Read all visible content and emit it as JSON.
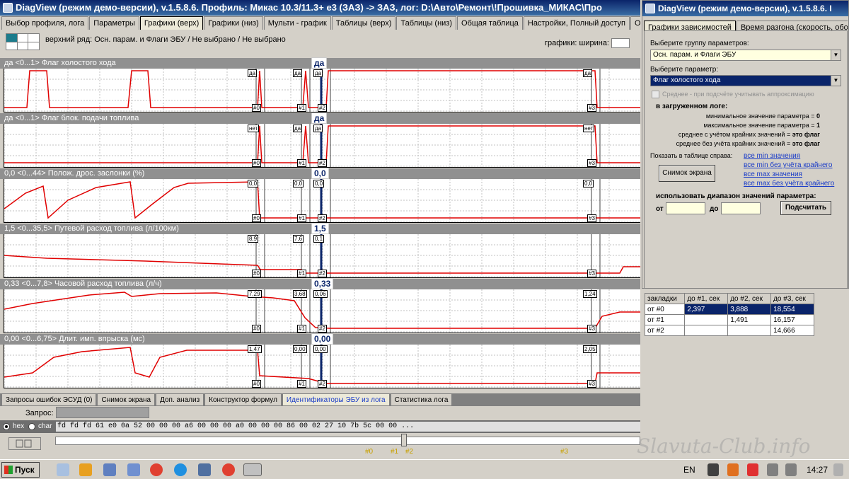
{
  "main_window": {
    "title": "DiagView (режим демо-версии), v.1.5.8.6. Профиль: Микас 10.3/11.3+ e3 (ЗАЗ) -> ЗАЗ,    лог: D:\\Авто\\Ремонт\\!Прошивка_МИКАС\\Про",
    "tabs": [
      "Выбор профиля, лога",
      "Параметры",
      "Графики (верх)",
      "Графики (низ)",
      "Мульти - график",
      "Таблицы (верх)",
      "Таблицы (низ)",
      "Общая таблица",
      "Настройки, Полный доступ",
      "О"
    ],
    "active_tab": "Графики (верх)",
    "top_row_label": "верхний ряд: Осн. парам. и Флаги ЭБУ / Не выбрано / Не выбрано",
    "graphs_label": "графики:  ширина:",
    "colors": {
      "header_bg": "#909090",
      "trace": "#e00000",
      "cursor": "#0a246a"
    }
  },
  "panels": [
    {
      "header": "да   <0...1>  Флаг холостого хода",
      "current": "да",
      "markers": [
        {
          "value": "да",
          "label": "#0"
        },
        {
          "value": "да",
          "label": "#1"
        },
        {
          "value": "да",
          "label": "#2"
        },
        {
          "value": "да",
          "label": "#3"
        }
      ]
    },
    {
      "header": "да   <0...1>  Флаг блок. подачи топлива",
      "current": "да",
      "markers": [
        {
          "value": "нет",
          "label": "#0"
        },
        {
          "value": "да",
          "label": "#1"
        },
        {
          "value": "да",
          "label": "#2"
        },
        {
          "value": "нет",
          "label": "#3"
        }
      ]
    },
    {
      "header": "0,0    <0...44>  Полож. дрос. заслонки (%)",
      "current": "0,0",
      "markers": [
        {
          "value": "0,0",
          "label": "#0"
        },
        {
          "value": "0,0",
          "label": "#1"
        },
        {
          "value": "0,0",
          "label": "#2"
        },
        {
          "value": "0,0",
          "label": "#3"
        }
      ]
    },
    {
      "header": "1,5    <0...35,5>  Путевой расход топлива (л/100км)",
      "current": "1,5",
      "markers": [
        {
          "value": "8,9",
          "label": "#0"
        },
        {
          "value": "7,6",
          "label": "#1"
        },
        {
          "value": "0,1",
          "label": "#2"
        },
        {
          "value": "",
          "label": "#3"
        }
      ]
    },
    {
      "header": "0,33    <0...7,8>  Часовой расход топлива (л/ч)",
      "current": "0,33",
      "markers": [
        {
          "value": "7,29",
          "label": "#0"
        },
        {
          "value": "3,68",
          "label": "#1"
        },
        {
          "value": "0,06",
          "label": "#2"
        },
        {
          "value": "1,24",
          "label": "#3"
        }
      ]
    },
    {
      "header": "0,00    <0...6,75>  Длит. имп. впрыска (мс)",
      "current": "0,00",
      "markers": [
        {
          "value": "1,47",
          "label": "#0"
        },
        {
          "value": "0,00",
          "label": "#1"
        },
        {
          "value": "0,00",
          "label": "#2"
        },
        {
          "value": "2,05",
          "label": "#3"
        }
      ]
    }
  ],
  "bottom": {
    "tabs": [
      "Запросы ошибок ЭСУД (0)",
      "Снимок экрана",
      "Доп. анализ",
      "Конструктор формул",
      "Идентификаторы ЭБУ из лога",
      "Статистика лога"
    ],
    "request_label": "Запрос:",
    "radio_hex": "hex",
    "radio_char": "char",
    "hexdump": "fd fd fd 61 e0 0a 52 00 00 00 a6 00 00 00 a0 00 00 00 86 00 02 27 10 7b 5c 00 00 ...",
    "timeline_marks": [
      "#0",
      "#1",
      "#2",
      "#3"
    ]
  },
  "side_window": {
    "title": "DiagView (режим демо-версии), v.1.5.8.6. I",
    "tabs": [
      "Графики зависимостей",
      "Время разгона (скорость, обороты и т"
    ],
    "group_label": "Выберите группу параметров:",
    "group_value": "Осн. парам. и Флаги ЭБУ",
    "param_label": "Выберите параметр:",
    "param_value": "Флаг холостого хода",
    "checkbox_label": "Среднее - при подсчёте учитывать аппроксимацию",
    "loaded_label": "в загруженном логе:",
    "min_label": "минимальное значение параметра =",
    "min_value": "0",
    "max_label": "максимальное значение параметра =",
    "max_value": "1",
    "avg1_label": "среднее с учётом крайних значений =",
    "avg1_value": "это флаг",
    "avg2_label": "среднее без учёта крайних значений =",
    "avg2_value": "это флаг",
    "show_label": "Показать в таблице справа:",
    "links": [
      "все min значения",
      "все min без учёта крайнего",
      "все max значения",
      "все max без учёта крайнего"
    ],
    "snapshot_button": "Снимок экрана",
    "range_label": "использовать диапазон значений параметра:",
    "from_label": "от",
    "to_label": "до",
    "calc_button": "Подсчитать"
  },
  "stats_table": {
    "headers": [
      "закладки",
      "до #1, сек",
      "до #2, сек",
      "до #3, сек"
    ],
    "rows": [
      [
        "от #0",
        "2,397",
        "3,888",
        "18,554"
      ],
      [
        "от #1",
        "",
        "1,491",
        "16,157"
      ],
      [
        "от #2",
        "",
        "",
        "14,666"
      ]
    ]
  },
  "taskbar": {
    "start": "Пуск",
    "lang": "EN",
    "clock": "14:27"
  },
  "watermark": "Slavuta-Club.info"
}
